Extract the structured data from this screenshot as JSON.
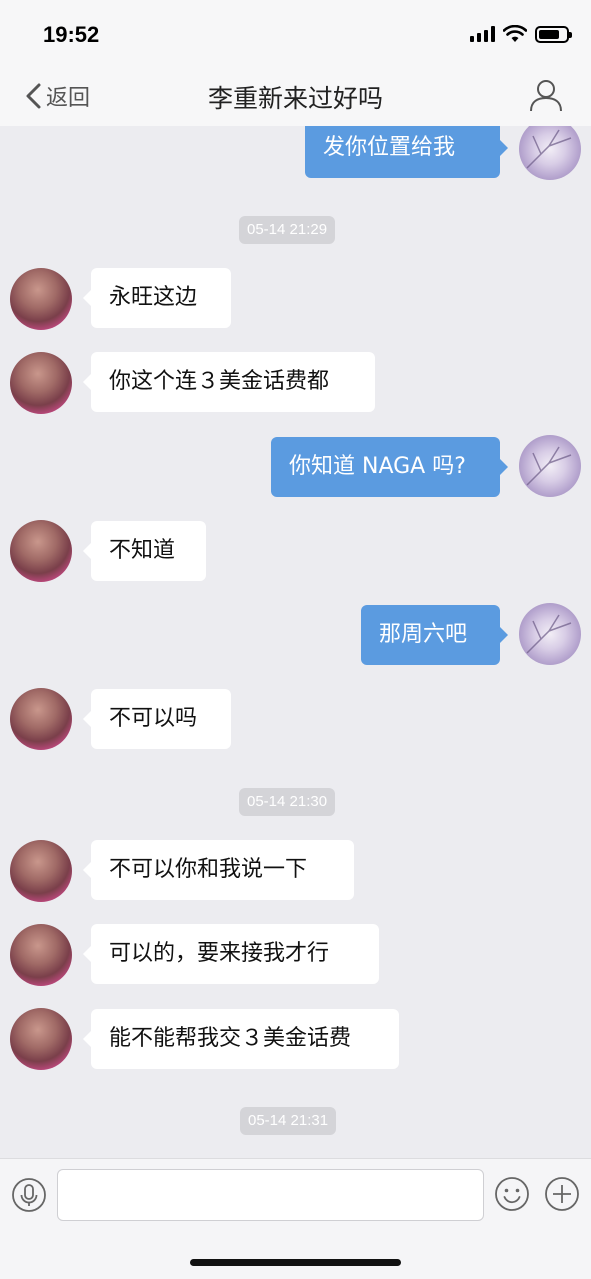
{
  "status_bar": {
    "time": "19:52"
  },
  "nav": {
    "back_label": "返回",
    "title": "李重新来过好吗"
  },
  "messages": [
    {
      "side": "me",
      "text": "发你位置给我"
    },
    {
      "type": "timestamp",
      "text": "05-14 21:29"
    },
    {
      "side": "them",
      "text": "永旺这边"
    },
    {
      "side": "them",
      "text": "你这个连３美金话费都"
    },
    {
      "side": "me",
      "text": "你知道 NAGA 吗?"
    },
    {
      "side": "them",
      "text": "不知道"
    },
    {
      "side": "me",
      "text": "那周六吧"
    },
    {
      "side": "them",
      "text": "不可以吗"
    },
    {
      "type": "timestamp",
      "text": "05-14 21:30"
    },
    {
      "side": "them",
      "text": "不可以你和我说一下"
    },
    {
      "side": "them",
      "text": "可以的，要来接我才行"
    },
    {
      "side": "them",
      "text": "能不能帮我交３美金话费"
    },
    {
      "type": "timestamp",
      "text": "05-14 21:31"
    }
  ],
  "input_bar": {
    "value": "",
    "placeholder": ""
  },
  "icons": {
    "back": "chevron-left-icon",
    "profile": "person-icon",
    "voice": "microphone-icon",
    "emoji": "smiley-icon",
    "more": "plus-icon"
  },
  "colors": {
    "sent_bubble": "#5b9be0",
    "received_bubble": "#ffffff",
    "chat_background": "#ececf0",
    "timestamp_bg": "#d4d4d8"
  }
}
